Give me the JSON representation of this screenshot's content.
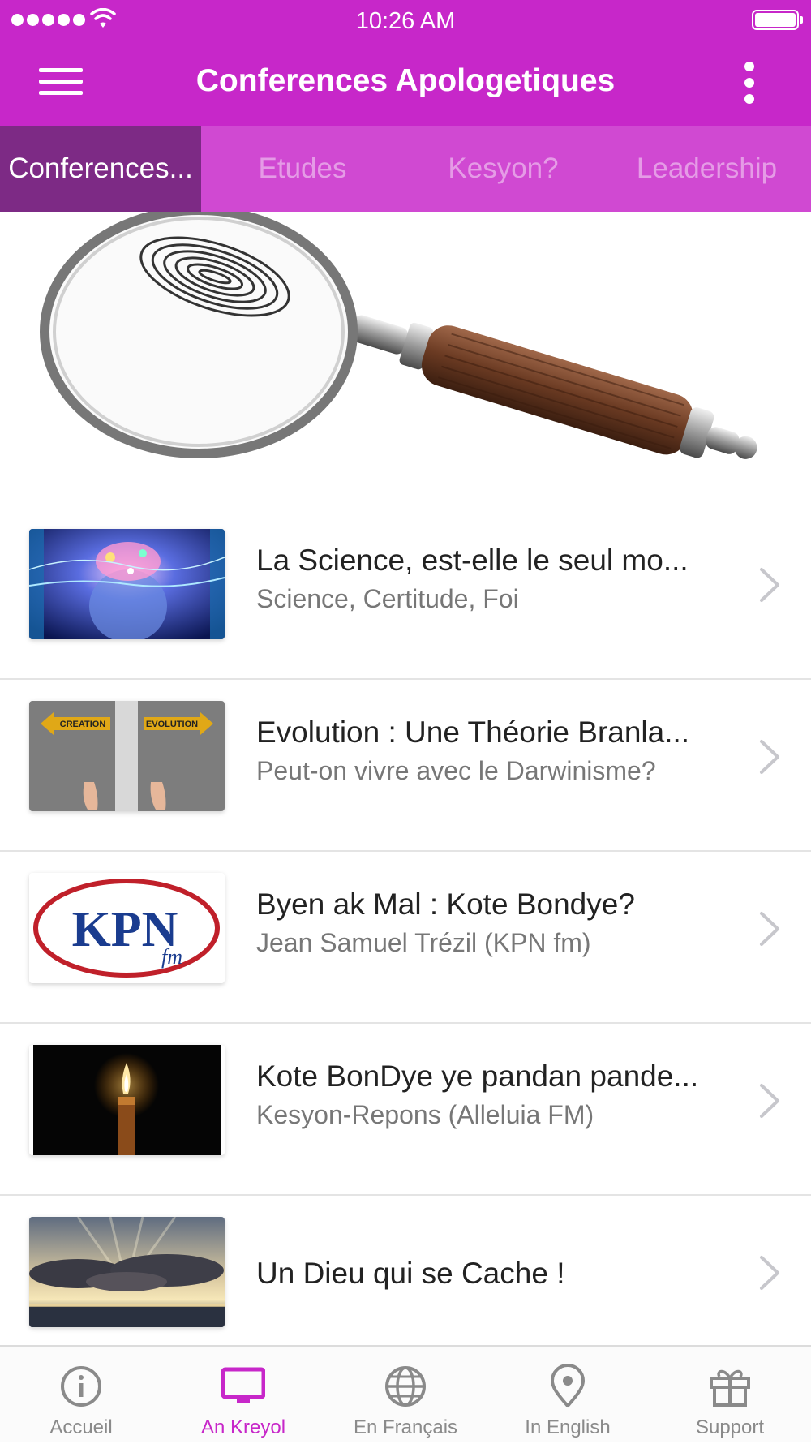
{
  "status_bar": {
    "time": "10:26 AM"
  },
  "header": {
    "title": "Conferences Apologetiques"
  },
  "tabs": [
    {
      "label": "Conferences...",
      "active": true
    },
    {
      "label": "Etudes",
      "active": false
    },
    {
      "label": "Kesyon?",
      "active": false
    },
    {
      "label": "Leadership",
      "active": false
    }
  ],
  "list": [
    {
      "title": "La Science, est-elle le seul mo...",
      "subtitle": "Science, Certitude, Foi",
      "thumb": "brain-light-image"
    },
    {
      "title": "Evolution : Une Théorie Branla...",
      "subtitle": "Peut-on vivre avec le Darwinisme?",
      "thumb": "creation-evolution-image",
      "thumb_text": [
        "CREATION",
        "EVOLUTION"
      ]
    },
    {
      "title": "Byen ak Mal : Kote Bondye?",
      "subtitle": "Jean Samuel Trézil (KPN fm)",
      "thumb": "kpn-fm-logo",
      "thumb_text": [
        "KPN",
        "fm"
      ]
    },
    {
      "title": "Kote BonDye ye pandan pande...",
      "subtitle": "Kesyon-Repons (Alleluia FM)",
      "thumb": "candle-image"
    },
    {
      "title": "Un Dieu qui se Cache !",
      "subtitle": "",
      "thumb": "clouds-sky-image"
    }
  ],
  "bottom_tabs": [
    {
      "label": "Accueil",
      "icon": "info-icon",
      "active": false
    },
    {
      "label": "An Kreyol",
      "icon": "monitor-icon",
      "active": true
    },
    {
      "label": "En Français",
      "icon": "globe-icon",
      "active": false
    },
    {
      "label": "In English",
      "icon": "location-pin-icon",
      "active": false
    },
    {
      "label": "Support",
      "icon": "gift-icon",
      "active": false
    }
  ],
  "colors": {
    "accent": "#c727c9",
    "tab_bar": "#d049d2",
    "tab_active": "#7d2a85",
    "inactive": "#8a8a8a"
  }
}
